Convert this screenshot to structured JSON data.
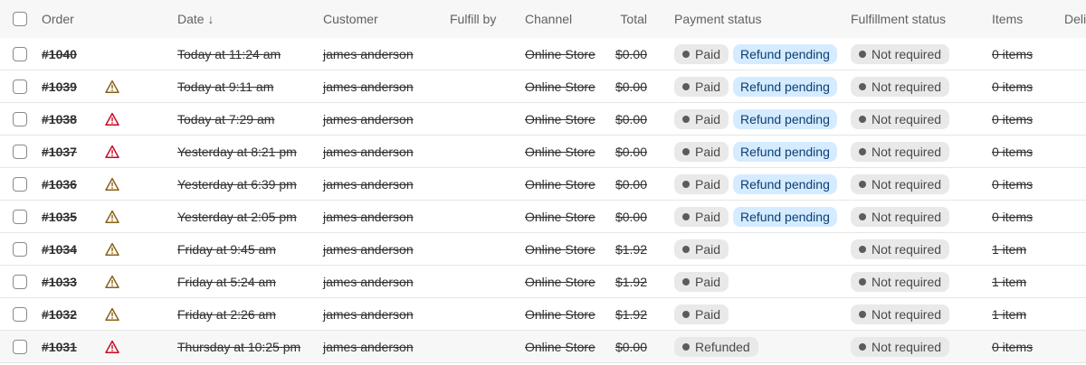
{
  "header": {
    "order": "Order",
    "date": "Date ↓",
    "customer": "Customer",
    "fulfill_by": "Fulfill by",
    "channel": "Channel",
    "total": "Total",
    "payment_status": "Payment status",
    "fulfillment_status": "Fulfillment status",
    "items": "Items",
    "delivery": "Deli"
  },
  "colors": {
    "warning": "#8a6116",
    "critical": "#c70a24",
    "refund_badge_bg": "#d5ebff",
    "status_badge_bg": "#e9e9e9"
  },
  "rows": [
    {
      "order": "#1040",
      "alert": "none",
      "date": "Today at 11:24 am",
      "customer": "james anderson",
      "channel": "Online Store",
      "total": "$0.00",
      "payment": "Paid",
      "refund": "Refund pending",
      "fulfillment": "Not required",
      "items": "0 items"
    },
    {
      "order": "#1039",
      "alert": "warning-icon",
      "date": "Today at 9:11 am",
      "customer": "james anderson",
      "channel": "Online Store",
      "total": "$0.00",
      "payment": "Paid",
      "refund": "Refund pending",
      "fulfillment": "Not required",
      "items": "0 items"
    },
    {
      "order": "#1038",
      "alert": "critical-icon",
      "date": "Today at 7:29 am",
      "customer": "james anderson",
      "channel": "Online Store",
      "total": "$0.00",
      "payment": "Paid",
      "refund": "Refund pending",
      "fulfillment": "Not required",
      "items": "0 items"
    },
    {
      "order": "#1037",
      "alert": "critical-icon",
      "date": "Yesterday at 8:21 pm",
      "customer": "james anderson",
      "channel": "Online Store",
      "total": "$0.00",
      "payment": "Paid",
      "refund": "Refund pending",
      "fulfillment": "Not required",
      "items": "0 items"
    },
    {
      "order": "#1036",
      "alert": "warning-icon",
      "date": "Yesterday at 6:39 pm",
      "customer": "james anderson",
      "channel": "Online Store",
      "total": "$0.00",
      "payment": "Paid",
      "refund": "Refund pending",
      "fulfillment": "Not required",
      "items": "0 items"
    },
    {
      "order": "#1035",
      "alert": "warning-icon",
      "date": "Yesterday at 2:05 pm",
      "customer": "james anderson",
      "channel": "Online Store",
      "total": "$0.00",
      "payment": "Paid",
      "refund": "Refund pending",
      "fulfillment": "Not required",
      "items": "0 items"
    },
    {
      "order": "#1034",
      "alert": "warning-icon",
      "date": "Friday at 9:45 am",
      "customer": "james anderson",
      "channel": "Online Store",
      "total": "$1.92",
      "payment": "Paid",
      "refund": "",
      "fulfillment": "Not required",
      "items": "1 item"
    },
    {
      "order": "#1033",
      "alert": "warning-icon",
      "date": "Friday at 5:24 am",
      "customer": "james anderson",
      "channel": "Online Store",
      "total": "$1.92",
      "payment": "Paid",
      "refund": "",
      "fulfillment": "Not required",
      "items": "1 item"
    },
    {
      "order": "#1032",
      "alert": "warning-icon",
      "date": "Friday at 2:26 am",
      "customer": "james anderson",
      "channel": "Online Store",
      "total": "$1.92",
      "payment": "Paid",
      "refund": "",
      "fulfillment": "Not required",
      "items": "1 item"
    },
    {
      "order": "#1031",
      "alert": "critical-icon",
      "date": "Thursday at 10:25 pm",
      "customer": "james anderson",
      "channel": "Online Store",
      "total": "$0.00",
      "payment": "Refunded",
      "refund": "",
      "fulfillment": "Not required",
      "items": "0 items"
    }
  ]
}
